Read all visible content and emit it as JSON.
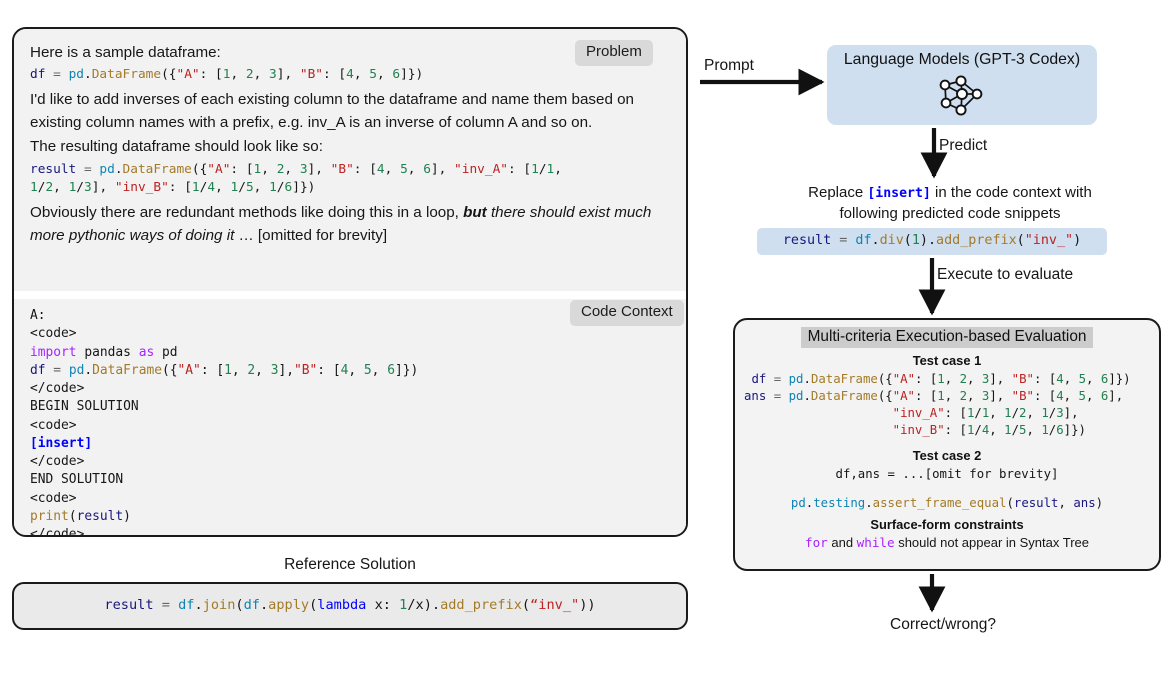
{
  "left_card": {
    "problem_badge": "Problem",
    "code_context_badge": "Code Context",
    "problem": {
      "line1": "Here is a sample dataframe:",
      "code1": "df = pd.DataFrame({\"A\": [1, 2, 3], \"B\": [4, 5, 6]})",
      "line2": "I'd like to add inverses of each existing column to the dataframe and name them based on existing column names with a prefix, e.g. inv_A is an inverse of column A and so on.",
      "line3": "The resulting dataframe should look like so:",
      "code2": "result = pd.DataFrame({\"A\": [1, 2, 3], \"B\": [4, 5, 6], \"inv_A\": [1/1,\n1/2, 1/3], \"inv_B\": [1/4, 1/5, 1/6]})",
      "line4_plain": "Obviously there are redundant methods like doing this in a loop, ",
      "line4_bolditalic": "but",
      "line4_italic": " there should exist much more pythonic ways of doing it",
      "line4_tail": " … [omitted for brevity]"
    },
    "code_context_lines": [
      "A:",
      "<code>",
      "import pandas as pd",
      "df = pd.DataFrame({\"A\": [1, 2, 3],\"B\": [4, 5, 6]})",
      "</code>",
      "BEGIN SOLUTION",
      "<code>",
      "[insert]",
      "</code>",
      "END SOLUTION",
      "<code>",
      "print(result)",
      "</code>"
    ]
  },
  "reference": {
    "label": "Reference Solution",
    "code": "result = df.join(df.apply(lambda x: 1/x).add_prefix(“inv_\"))"
  },
  "flow": {
    "prompt_label": "Prompt",
    "predict_label": "Predict",
    "execute_label": "Execute to evaluate",
    "result_label": "Correct/wrong?"
  },
  "lm_box": {
    "title": "Language Models (GPT-3 Codex)",
    "icon": "neural-network-icon",
    "color": "#cfdfef"
  },
  "replace": {
    "text_before": "Replace ",
    "insert_token": "[insert]",
    "text_after": " in the code context with",
    "line2": "following predicted code snippets",
    "predicted_code": "result = df.div(1).add_prefix(\"inv_\")"
  },
  "evaluation": {
    "title": "Multi-criteria Execution-based Evaluation",
    "test_case_1_head": "Test case 1",
    "test_case_1_code": "df = pd.DataFrame({\"A\": [1, 2, 3], \"B\": [4, 5, 6]})\nans = pd.DataFrame({\"A\": [1, 2, 3], \"B\": [4, 5, 6],\n                    \"inv_A\": [1/1, 1/2, 1/3],\n                    \"inv_B\": [1/4, 1/5, 1/6]})",
    "test_case_2_head": "Test case 2",
    "test_case_2_code": "df,ans = ...[omit for brevity]",
    "assert_code": "pd.testing.assert_frame_equal(result, ans)",
    "surface_head": "Surface-form constraints",
    "surface_kw1": "for",
    "surface_mid": " and ",
    "surface_kw2": "while",
    "surface_tail": " should not appear in Syntax Tree"
  },
  "colors": {
    "accent_blue": "#cfdfef",
    "panel_gray": "#f2f2f2",
    "badge_gray": "#d9d9d9",
    "border_black": "#1a1a1a",
    "keyword_purple": "#aa22ff",
    "string_red": "#bb2222",
    "number_green": "#208050",
    "insert_blue": "#0000ff"
  }
}
